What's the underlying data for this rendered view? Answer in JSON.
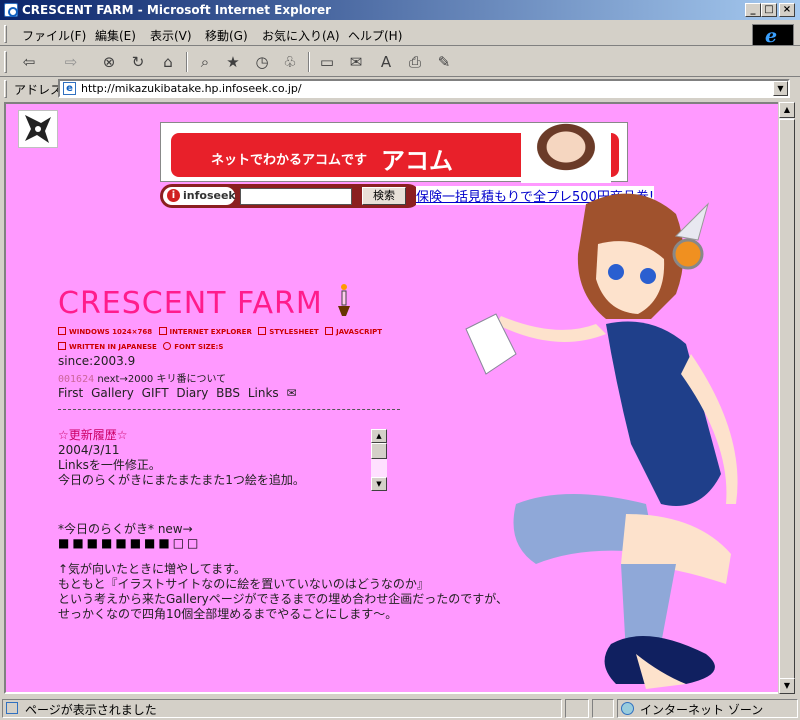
{
  "window": {
    "title": "CRESCENT FARM - Microsoft Internet Explorer"
  },
  "menu": [
    "ファイル(F)",
    "編集(E)",
    "表示(V)",
    "移動(G)",
    "お気に入り(A)",
    "ヘルプ(H)"
  ],
  "address": {
    "label": "アドレス",
    "url": "http://mikazukibatake.hp.infoseek.co.jp/"
  },
  "status": {
    "text": "ページが表示されました",
    "zone": "インターネット ゾーン"
  },
  "ad": {
    "banner_text": "ネットでわかるアコムです",
    "brand": "アコム",
    "link_text": "保険一括見積もりで全プレ500円商品券!"
  },
  "search": {
    "logo": "infoseek",
    "button": "検索"
  },
  "site": {
    "title": "CRESCENT FARM",
    "badges": [
      "WINDOWS 1024×768",
      "INTERNET EXPLORER",
      "STYLESHEET",
      "JAVASCRIPT",
      "WRITTEN IN JAPANESE",
      "FONT SIZE:S"
    ],
    "since": "since:2003.9",
    "counter": {
      "number": "001624",
      "next": "next→2000",
      "kiriban": "キリ番について"
    },
    "nav": [
      "First",
      "Gallery",
      "GIFT",
      "Diary",
      "BBS",
      "Links"
    ],
    "updates": {
      "title": "☆更新履歴☆",
      "lines": [
        "2004/3/11",
        "Linksを一件修正。",
        "今日のらくがきにまたまたまた1つ絵を追加。"
      ]
    },
    "rakugaki": "*今日のらくがき* new→",
    "squares": "■■■■■■■■□□",
    "body": [
      "↑気が向いたときに増やしてます。",
      "もともと『イラストサイトなのに絵を置いていないのはどうなのか』",
      "という考えから来たGalleryページができるまでの埋め合わせ企画だったのですが、",
      "せっかくなので四角10個全部埋めるまでやることにします〜。"
    ]
  }
}
